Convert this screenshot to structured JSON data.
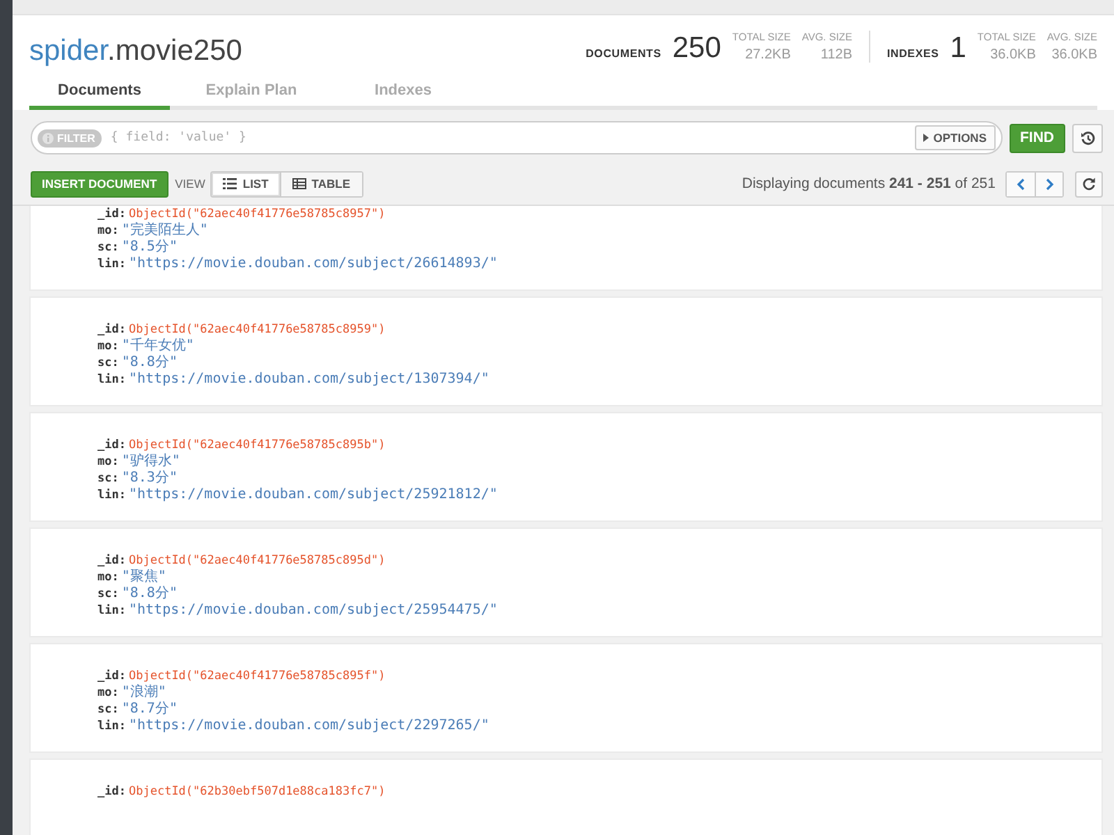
{
  "collection": {
    "database": "spider",
    "name": ".movie250"
  },
  "stats": [
    {
      "label": "DOCUMENTS",
      "count": "250",
      "sizes": [
        {
          "label": "TOTAL SIZE",
          "value": "27.2KB"
        },
        {
          "label": "AVG. SIZE",
          "value": "112B"
        }
      ]
    },
    {
      "label": "INDEXES",
      "count": "1",
      "sizes": [
        {
          "label": "TOTAL SIZE",
          "value": "36.0KB"
        },
        {
          "label": "AVG. SIZE",
          "value": "36.0KB"
        }
      ]
    }
  ],
  "tabs": [
    {
      "label": "Documents",
      "selected": true
    },
    {
      "label": "Explain Plan",
      "selected": false
    },
    {
      "label": "Indexes",
      "selected": false
    }
  ],
  "filter": {
    "badge": "FILTER",
    "placeholder": "{ field: 'value' }",
    "options_button": "OPTIONS",
    "find_button": "FIND"
  },
  "toolbar": {
    "insert_button": "INSERT DOCUMENT",
    "view_label": "VIEW",
    "views": [
      {
        "label": "LIST",
        "kind": "list",
        "selected": true
      },
      {
        "label": "TABLE",
        "kind": "table",
        "selected": false
      }
    ],
    "paging": "Displaying documents **241 - 251** of 251"
  },
  "documents": [
    {
      "fields": [
        {
          "key": "_id:",
          "kind": "objectid",
          "value": "ObjectId(\"62aec40f41776e58785c8957\")"
        },
        {
          "key": "mo:",
          "kind": "string",
          "value": "\"完美陌生人\""
        },
        {
          "key": "sc:",
          "kind": "string",
          "value": "\"8.5分\""
        },
        {
          "key": "lin:",
          "kind": "string",
          "value": "\"https://movie.douban.com/subject/26614893/\""
        }
      ]
    },
    {
      "fields": [
        {
          "key": "_id:",
          "kind": "objectid",
          "value": "ObjectId(\"62aec40f41776e58785c8959\")"
        },
        {
          "key": "mo:",
          "kind": "string",
          "value": "\"千年女优\""
        },
        {
          "key": "sc:",
          "kind": "string",
          "value": "\"8.8分\""
        },
        {
          "key": "lin:",
          "kind": "string",
          "value": "\"https://movie.douban.com/subject/1307394/\""
        }
      ]
    },
    {
      "fields": [
        {
          "key": "_id:",
          "kind": "objectid",
          "value": "ObjectId(\"62aec40f41776e58785c895b\")"
        },
        {
          "key": "mo:",
          "kind": "string",
          "value": "\"驴得水\""
        },
        {
          "key": "sc:",
          "kind": "string",
          "value": "\"8.3分\""
        },
        {
          "key": "lin:",
          "kind": "string",
          "value": "\"https://movie.douban.com/subject/25921812/\""
        }
      ]
    },
    {
      "fields": [
        {
          "key": "_id:",
          "kind": "objectid",
          "value": "ObjectId(\"62aec40f41776e58785c895d\")"
        },
        {
          "key": "mo:",
          "kind": "string",
          "value": "\"聚焦\""
        },
        {
          "key": "sc:",
          "kind": "string",
          "value": "\"8.8分\""
        },
        {
          "key": "lin:",
          "kind": "string",
          "value": "\"https://movie.douban.com/subject/25954475/\""
        }
      ]
    },
    {
      "fields": [
        {
          "key": "_id:",
          "kind": "objectid",
          "value": "ObjectId(\"62aec40f41776e58785c895f\")"
        },
        {
          "key": "mo:",
          "kind": "string",
          "value": "\"浪潮\""
        },
        {
          "key": "sc:",
          "kind": "string",
          "value": "\"8.7分\""
        },
        {
          "key": "lin:",
          "kind": "string",
          "value": "\"https://movie.douban.com/subject/2297265/\""
        }
      ]
    },
    {
      "fields": [
        {
          "key": "_id:",
          "kind": "objectid",
          "value": "ObjectId(\"62b30ebf507d1e88ca183fc7\")"
        }
      ]
    }
  ]
}
